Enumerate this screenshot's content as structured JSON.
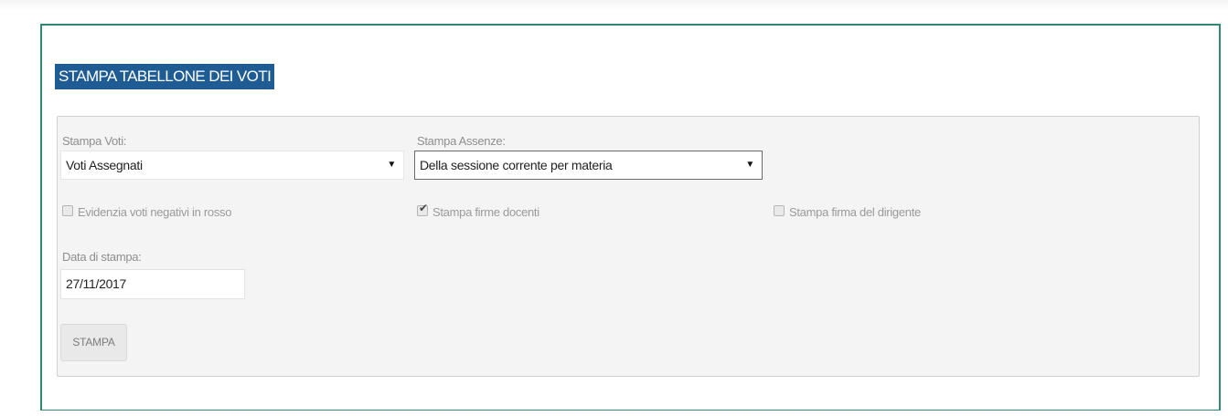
{
  "header": {
    "title": "STAMPA TABELLONE DEI VOTI"
  },
  "form": {
    "stampa_voti": {
      "label": "Stampa Voti:",
      "value": "Voti Assegnati"
    },
    "stampa_assenze": {
      "label": "Stampa Assenze:",
      "value": "Della sessione corrente per materia"
    },
    "checkboxes": [
      {
        "label": "Evidenzia voti negativi in rosso",
        "checked": false
      },
      {
        "label": "Stampa firme docenti",
        "checked": true
      },
      {
        "label": "Stampa firma del dirigente",
        "checked": false
      }
    ],
    "data_stampa": {
      "label": "Data di stampa:",
      "value": "27/11/2017"
    },
    "submit_label": "STAMPA"
  },
  "colors": {
    "panel_border": "#2e8a72",
    "title_background": "#1f5c94"
  }
}
